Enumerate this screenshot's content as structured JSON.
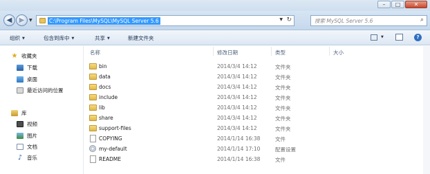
{
  "address": {
    "path": "C:\\Program Files\\MySQL\\MySQL Server 5.6",
    "search_placeholder": "搜索 MySQL Server 5.6"
  },
  "toolbar": {
    "organize": "组织",
    "include_in_library": "包含到库中",
    "share": "共享",
    "new_folder": "新建文件夹"
  },
  "navigation": {
    "favorites_label": "收藏夹",
    "favorites": [
      "下载",
      "桌面",
      "最近访问的位置"
    ],
    "libraries_label": "库",
    "libraries": [
      "视频",
      "图片",
      "文档",
      "音乐"
    ]
  },
  "columns": {
    "name": "名称",
    "modified": "修改日期",
    "type": "类型",
    "size": "大小"
  },
  "files": [
    {
      "name": "bin",
      "date": "2014/3/4 14:12",
      "type": "文件夹",
      "icon": "folder-icon"
    },
    {
      "name": "data",
      "date": "2014/3/4 14:12",
      "type": "文件夹",
      "icon": "folder-icon"
    },
    {
      "name": "docs",
      "date": "2014/3/4 14:12",
      "type": "文件夹",
      "icon": "folder-icon"
    },
    {
      "name": "include",
      "date": "2014/3/4 14:12",
      "type": "文件夹",
      "icon": "folder-icon"
    },
    {
      "name": "lib",
      "date": "2014/3/4 14:12",
      "type": "文件夹",
      "icon": "folder-icon"
    },
    {
      "name": "share",
      "date": "2014/3/4 14:12",
      "type": "文件夹",
      "icon": "folder-icon"
    },
    {
      "name": "support-files",
      "date": "2014/3/4 14:12",
      "type": "文件夹",
      "icon": "folder-icon"
    },
    {
      "name": "COPYING",
      "date": "2014/1/14 16:38",
      "type": "文件",
      "icon": "file-icon"
    },
    {
      "name": "my-default",
      "date": "2014/1/14 17:10",
      "type": "配置设置",
      "icon": "config-file-icon"
    },
    {
      "name": "README",
      "date": "2014/1/14 16:38",
      "type": "文件",
      "icon": "file-icon"
    }
  ]
}
